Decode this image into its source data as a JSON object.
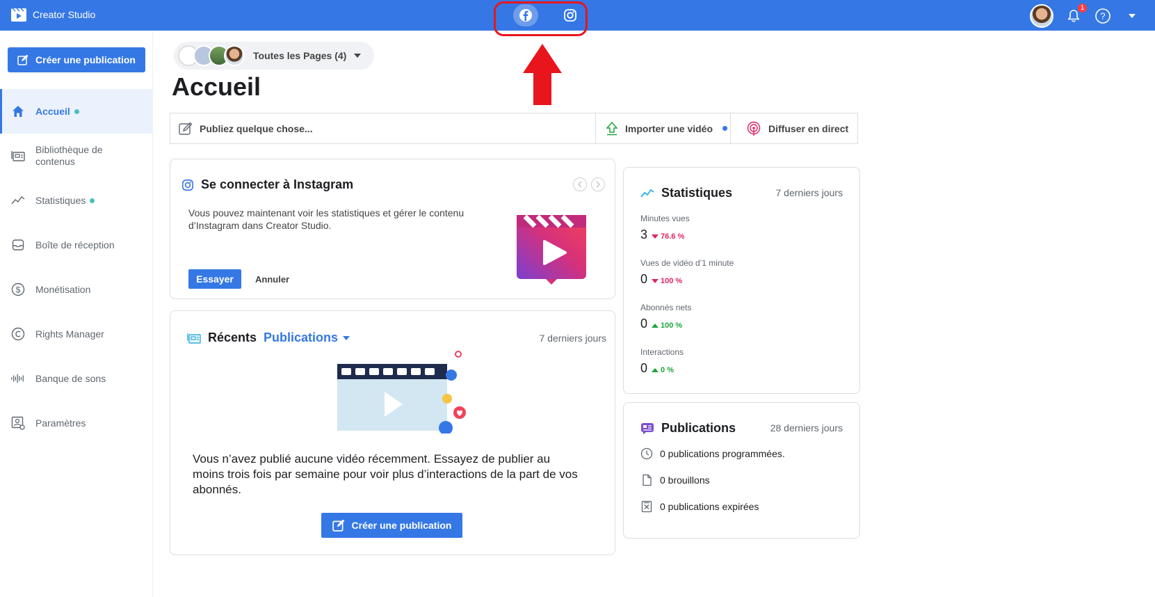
{
  "app": {
    "title": "Creator Studio"
  },
  "topbar": {
    "notification_count": "1",
    "help_label": "?"
  },
  "sidebar": {
    "create_label": "Créer une publication",
    "items": [
      {
        "label": "Accueil",
        "icon": "home-icon"
      },
      {
        "label": "Bibliothèque de contenus",
        "icon": "library-icon"
      },
      {
        "label": "Statistiques",
        "icon": "stats-icon"
      },
      {
        "label": "Boîte de réception",
        "icon": "inbox-icon"
      },
      {
        "label": "Monétisation",
        "icon": "dollar-icon"
      },
      {
        "label": "Rights Manager",
        "icon": "copyright-icon"
      },
      {
        "label": "Banque de sons",
        "icon": "sound-icon"
      },
      {
        "label": "Paramètres",
        "icon": "settings-icon"
      }
    ]
  },
  "pages": {
    "label": "Toutes les Pages (4)"
  },
  "main": {
    "title": "Accueil",
    "actions": {
      "post": "Publiez quelque chose...",
      "import": "Importer une vidéo",
      "live": "Diffuser en direct"
    }
  },
  "instagram": {
    "title": "Se connecter à Instagram",
    "description": "Vous pouvez maintenant voir les statistiques et gérer le contenu d’Instagram dans Creator Studio.",
    "try_label": "Essayer",
    "cancel_label": "Annuler"
  },
  "recent": {
    "title": "Récents",
    "filter": "Publications",
    "range": "7 derniers jours",
    "empty_text": "Vous n’avez publié aucune vidéo récemment. Essayez de publier au moins trois fois par semaine pour voir plus d’interactions de la part de vos abonnés.",
    "create_label": "Créer une publication"
  },
  "stats": {
    "title": "Statistiques",
    "range": "7 derniers jours",
    "metrics": [
      {
        "label": "Minutes vues",
        "value": "3",
        "change": "76.6 %",
        "direction": "down"
      },
      {
        "label": "Vues de vidéo d’1 minute",
        "value": "0",
        "change": "100 %",
        "direction": "down"
      },
      {
        "label": "Abonnés nets",
        "value": "0",
        "change": "100 %",
        "direction": "up"
      },
      {
        "label": "Interactions",
        "value": "0",
        "change": "0 %",
        "direction": "up"
      }
    ]
  },
  "publications": {
    "title": "Publications",
    "range": "28 derniers jours",
    "rows": [
      {
        "label": "0 publications programmées.",
        "icon": "clock-icon"
      },
      {
        "label": "0 brouillons",
        "icon": "draft-icon"
      },
      {
        "label": "0 publications expirées",
        "icon": "expired-icon"
      }
    ]
  },
  "colors": {
    "primary": "#3578e5",
    "accent_teal": "#4bbfbf",
    "down": "#e0245e",
    "up": "#1ea53b",
    "annotation": "#e8151d"
  }
}
